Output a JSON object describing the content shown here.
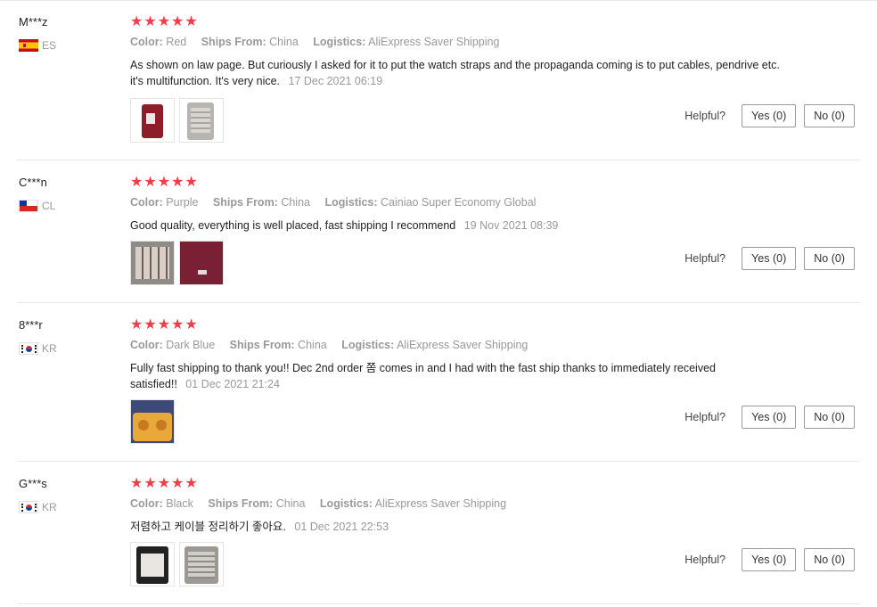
{
  "ui": {
    "helpful_label": "Helpful?",
    "color_label": "Color:",
    "ships_from_label": "Ships From:",
    "logistics_label": "Logistics:",
    "star_color": "#f53d4a"
  },
  "reviews": [
    {
      "user": "M***z",
      "country_code": "ES",
      "flag_icon": "spain-flag-icon",
      "rating": "★★★★★",
      "color": "Red",
      "ships_from": "China",
      "logistics": "AliExpress Saver Shipping",
      "text": "As shown on law page. But curiously I asked for it to put the watch straps and the propaganda coming is to put cables, pendrive etc. it's multifunction. It's very nice.",
      "date": "17 Dec 2021 06:19",
      "yes_label": "Yes (0)",
      "no_label": "No (0)"
    },
    {
      "user": "C***n",
      "country_code": "CL",
      "flag_icon": "chile-flag-icon",
      "rating": "★★★★★",
      "color": "Purple",
      "ships_from": "China",
      "logistics": "Cainiao Super Economy Global",
      "text": "Good quality, everything is well placed, fast shipping I recommend",
      "date": "19 Nov 2021 08:39",
      "yes_label": "Yes (0)",
      "no_label": "No (0)"
    },
    {
      "user": "8***r",
      "country_code": "KR",
      "flag_icon": "korea-flag-icon",
      "rating": "★★★★★",
      "color": "Dark Blue",
      "ships_from": "China",
      "logistics": "AliExpress Saver Shipping",
      "text": "Fully fast shipping to thank you!! Dec 2nd order 쫌 comes in and I had with the fast ship thanks to immediately received satisfied!!",
      "date": "01 Dec 2021 21:24",
      "yes_label": "Yes (0)",
      "no_label": "No (0)"
    },
    {
      "user": "G***s",
      "country_code": "KR",
      "flag_icon": "korea-flag-icon",
      "rating": "★★★★★",
      "color": "Black",
      "ships_from": "China",
      "logistics": "AliExpress Saver Shipping",
      "text": "저렴하고 케이블 정리하기 좋아요.",
      "date": "01 Dec 2021 22:53",
      "yes_label": "Yes (0)",
      "no_label": "No (0)"
    }
  ]
}
